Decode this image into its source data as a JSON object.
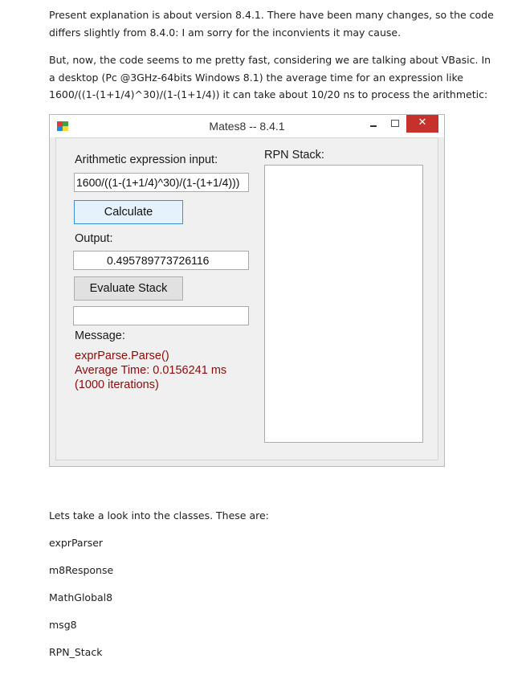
{
  "document": {
    "paragraph1": "Present explanation is about version 8.4.1. There have been many changes, so the code differs slightly from 8.4.0: I am sorry for the inconvients it may cause.",
    "paragraph2": "But, now, the code seems to me pretty fast, considering we are talking about VBasic. In a desktop (Pc @3GHz-64bits Windows 8.1) the average time for an expression like  1600/((1-(1+1/4)^30)/(1-(1+1/4))  it can take about 10/20 ns to process the arithmetic:",
    "classes_intro": "Lets take a look into the classes. These are:",
    "classes": [
      "exprParser",
      "m8Response",
      "MathGlobal8",
      "msg8",
      "RPN_Stack"
    ]
  },
  "window": {
    "title": "Mates8 -- 8.4.1",
    "close_glyph": "✕",
    "input_label": "Arithmetic expression input:",
    "input_value": "1600/((1-(1+1/4)^30)/(1-(1+1/4)))",
    "calculate_label": "Calculate",
    "output_label": "Output:",
    "output_value": "0.495789773726116",
    "evaluate_label": "Evaluate Stack",
    "stack_eval_value": "",
    "message_label": "Message:",
    "message_line1": "exprParse.Parse()",
    "message_line2": "Average Time: 0.0156241 ms",
    "message_line3": "(1000 iterations)",
    "rpn_label": "RPN Stack:",
    "colors": {
      "close": "#c7312b",
      "message": "#8b0b0b",
      "focus_border": "#3c8fdc"
    }
  }
}
